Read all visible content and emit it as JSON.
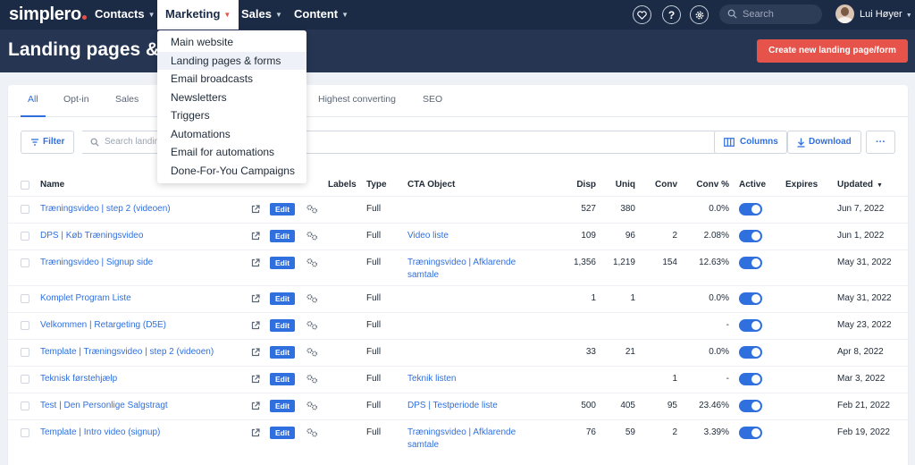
{
  "topnav": {
    "logo": "simplero",
    "items": [
      {
        "label": "Contacts"
      },
      {
        "label": "Marketing"
      },
      {
        "label": "Sales"
      },
      {
        "label": "Content"
      }
    ],
    "search_placeholder": "Search",
    "user_name": "Lui Høyer"
  },
  "header": {
    "title": "Landing pages & forms",
    "create_button": "Create new landing page/form"
  },
  "marketing_menu": [
    {
      "label": "Main website"
    },
    {
      "label": "Landing pages & forms"
    },
    {
      "label": "Email broadcasts"
    },
    {
      "label": "Newsletters"
    },
    {
      "label": "Triggers"
    },
    {
      "label": "Automations"
    },
    {
      "label": "Email for automations"
    },
    {
      "label": "Done-For-You Campaigns"
    }
  ],
  "tabs": [
    {
      "label": "All"
    },
    {
      "label": "Opt-in"
    },
    {
      "label": "Sales"
    },
    {
      "label": "Highest converting"
    },
    {
      "label": "SEO"
    }
  ],
  "toolbar": {
    "filter_label": "Filter",
    "search_placeholder": "Search landing",
    "columns_label": "Columns",
    "download_label": "Download",
    "more_label": "···"
  },
  "columns": {
    "name": "Name",
    "labels": "Labels",
    "type": "Type",
    "cta": "CTA Object",
    "disp": "Disp",
    "uniq": "Uniq",
    "conv": "Conv",
    "convp": "Conv %",
    "active": "Active",
    "expires": "Expires",
    "updated": "Updated"
  },
  "edit_label": "Edit",
  "rows": [
    {
      "name": "Træningsvideo | step 2 (videoen)",
      "type": "Full",
      "cta": "",
      "disp": "527",
      "uniq": "380",
      "conv": "",
      "convp": "0.0%",
      "active": true,
      "updated": "Jun 7, 2022"
    },
    {
      "name": "DPS | Køb Træningsvideo",
      "type": "Full",
      "cta": "Video liste",
      "disp": "109",
      "uniq": "96",
      "conv": "2",
      "convp": "2.08%",
      "active": true,
      "updated": "Jun 1, 2022"
    },
    {
      "name": "Træningsvideo | Signup side",
      "type": "Full",
      "cta": "Træningsvideo | Afklarende",
      "cta2": "samtale",
      "disp": "1,356",
      "uniq": "1,219",
      "conv": "154",
      "convp": "12.63%",
      "active": true,
      "updated": "May 31, 2022"
    },
    {
      "name": "Komplet Program Liste",
      "type": "Full",
      "cta": "",
      "disp": "1",
      "uniq": "1",
      "conv": "",
      "convp": "0.0%",
      "active": true,
      "updated": "May 31, 2022"
    },
    {
      "name": "Velkommen | Retargeting (D5E)",
      "type": "Full",
      "cta": "",
      "disp": "",
      "uniq": "",
      "conv": "",
      "convp": "-",
      "active": true,
      "updated": "May 23, 2022"
    },
    {
      "name": "Template | Træningsvideo | step 2 (videoen)",
      "type": "Full",
      "cta": "",
      "disp": "33",
      "uniq": "21",
      "conv": "",
      "convp": "0.0%",
      "active": true,
      "updated": "Apr 8, 2022"
    },
    {
      "name": "Teknisk førstehjælp",
      "type": "Full",
      "cta": "Teknik listen",
      "disp": "",
      "uniq": "",
      "conv": "1",
      "convp": "-",
      "active": true,
      "updated": "Mar 3, 2022"
    },
    {
      "name": "Test | Den Personlige Salgstragt",
      "type": "Full",
      "cta": "DPS | Testperiode liste",
      "disp": "500",
      "uniq": "405",
      "conv": "95",
      "convp": "23.46%",
      "active": true,
      "updated": "Feb 21, 2022"
    },
    {
      "name": "Template | Intro video (signup)",
      "type": "Full",
      "cta": "Træningsvideo | Afklarende",
      "cta2": "samtale",
      "disp": "76",
      "uniq": "59",
      "conv": "2",
      "convp": "3.39%",
      "active": true,
      "updated": "Feb 19, 2022"
    }
  ],
  "colors": {
    "nav": "#1b2a45",
    "header": "#253552",
    "accent": "#2f6fde",
    "create": "#e5534b"
  }
}
